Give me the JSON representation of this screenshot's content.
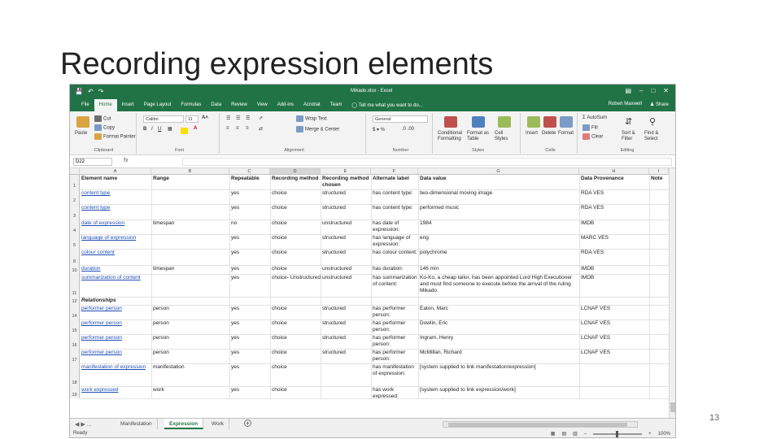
{
  "slide": {
    "title": "Recording expression elements",
    "page_number": "13"
  },
  "window": {
    "title": "Mikado.xlsx - Excel",
    "user": "Robert Maxwell",
    "share": "Share",
    "quick_access": [
      "save-icon",
      "undo-icon",
      "redo-icon"
    ]
  },
  "menu": {
    "tabs": [
      "File",
      "Home",
      "Insert",
      "Page Layout",
      "Formulas",
      "Data",
      "Review",
      "View",
      "Add-ins",
      "Acrobat",
      "Team"
    ],
    "active_tab": "Home",
    "tell_me": "Tell me what you want to do..."
  },
  "ribbon": {
    "clipboard": {
      "paste": "Paste",
      "cut": "Cut",
      "copy": "Copy",
      "format_painter": "Format Painter",
      "label": "Clipboard"
    },
    "font": {
      "name": "Calibri",
      "size": "11",
      "label": "Font"
    },
    "alignment": {
      "wrap_text": "Wrap Text",
      "merge_center": "Merge & Center",
      "label": "Alignment"
    },
    "number": {
      "format": "General",
      "label": "Number"
    },
    "styles": {
      "conditional": "Conditional Formatting",
      "format_table": "Format as Table",
      "cell_styles": "Cell Styles",
      "label": "Styles"
    },
    "cells": {
      "insert": "Insert",
      "delete": "Delete",
      "format": "Format",
      "label": "Cells"
    },
    "editing": {
      "autosum": "AutoSum",
      "fill": "Fill",
      "clear": "Clear",
      "sort_filter": "Sort & Filter",
      "find_select": "Find & Select",
      "label": "Editing"
    }
  },
  "formula_bar": {
    "name_box": "D22",
    "fx": "fx",
    "content": ""
  },
  "columns": [
    "A",
    "B",
    "C",
    "D",
    "E",
    "F",
    "G",
    "H",
    "I"
  ],
  "selected_column": "D",
  "header_row": {
    "row_num": "1",
    "cells": [
      "Element name",
      "Range",
      "Repeatable",
      "Recording method",
      "Recording method chosen",
      "Alternate label",
      "Data value",
      "Data Provenance",
      "Note"
    ]
  },
  "rows": [
    {
      "num": "2",
      "cells": [
        "content type",
        "",
        "yes",
        "choice",
        "structured",
        "has content type:",
        "two-dimensional moving image",
        "RDA VES",
        ""
      ]
    },
    {
      "num": "3",
      "cells": [
        "content type",
        "",
        "yes",
        "choice",
        "structured",
        "has content type:",
        "performed music",
        "RDA VES",
        ""
      ]
    },
    {
      "num": "4",
      "cells": [
        "date of expression",
        "timespan",
        "no",
        "choice",
        "unstructured",
        "has date of expression:",
        "1984",
        "IMDB",
        ""
      ]
    },
    {
      "num": "5",
      "cells": [
        "language of expression",
        "",
        "yes",
        "choice",
        "structured",
        "has language of expression:",
        "eng",
        "MARC VES",
        ""
      ]
    },
    {
      "num": "8",
      "cells": [
        "colour content",
        "",
        "yes",
        "choice",
        "structured",
        "has colour content:",
        "polychrome",
        "RDA VES",
        ""
      ]
    },
    {
      "num": "10",
      "cells": [
        "duration",
        "timespan",
        "yes",
        "choice",
        "unstructured",
        "has duration:",
        "146 min",
        "IMDB",
        ""
      ]
    },
    {
      "num": "11",
      "cells": [
        "summarization of content",
        "",
        "yes",
        "choice- Unstructured",
        "unstructured",
        "has summarization of content:",
        "Ko-Ko, a cheap tailor, has been appointed Lord High Executioner and must find someone to execute before the arrival of the ruling Mikado.",
        "IMDB",
        ""
      ]
    },
    {
      "num": "12",
      "cells": [
        "Relationships",
        "",
        "",
        "",
        "",
        "",
        "",
        "",
        ""
      ]
    },
    {
      "num": "14",
      "cells": [
        "performer person",
        "person",
        "yes",
        "choice",
        "structured",
        "has performer person:",
        "Eaton, Marc",
        "LCNAF VES",
        ""
      ]
    },
    {
      "num": "15",
      "cells": [
        "performer person",
        "person",
        "yes",
        "choice",
        "structured",
        "has performer person:",
        "Dowlin, Eric",
        "LCNAF VES",
        ""
      ]
    },
    {
      "num": "16",
      "cells": [
        "performer person",
        "person",
        "yes",
        "choice",
        "structured",
        "has performer person:",
        "Ingram, Henry",
        "LCNAF VES",
        ""
      ]
    },
    {
      "num": "17",
      "cells": [
        "performer person",
        "person",
        "yes",
        "choice",
        "structured",
        "has performer person:",
        "McMillan, Richard",
        "LCNAF VES",
        ""
      ]
    },
    {
      "num": "18",
      "cells": [
        "manifestation of expression",
        "manifestation",
        "yes",
        "choice",
        "",
        "has manifestation of expression:",
        "[system supplied to link manifestation/expression]",
        "",
        ""
      ]
    },
    {
      "num": "19",
      "cells": [
        "work expressed",
        "work",
        "yes",
        "choice",
        "",
        "has work expressed:",
        "[system supplied to link expression/work]",
        "",
        ""
      ]
    }
  ],
  "sheets": [
    "Manifestation",
    "Expression",
    "Work"
  ],
  "active_sheet": "Expression",
  "status": {
    "ready": "Ready",
    "zoom": "100%"
  },
  "colors": {
    "excel_green": "#217346",
    "link_blue": "#1f4eb4"
  }
}
